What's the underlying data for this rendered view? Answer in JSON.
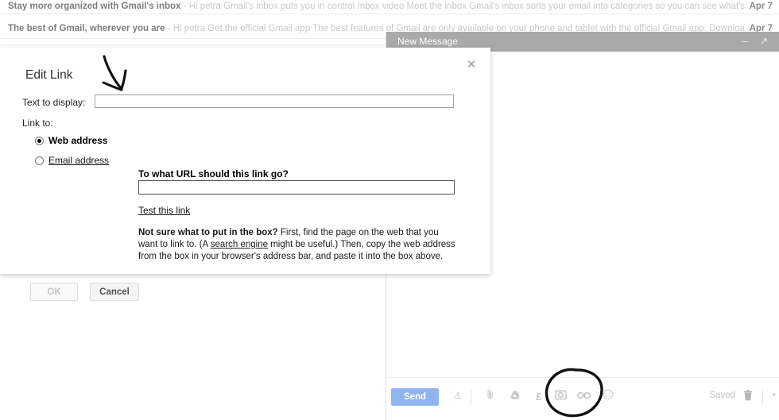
{
  "inbox": {
    "rows": [
      {
        "subject": "Stay more organized with Gmail's inbox",
        "dash": " - ",
        "snippet": "Hi petra Gmail's inbox puts you in control Inbox video Meet the inbox Gmail's inbox sorts your email into categories so you can see what's",
        "date": "Apr 7"
      },
      {
        "subject": "The best of Gmail, wherever you are",
        "dash": " - ",
        "snippet": "Hi petra Get the official Gmail app The best features of Gmail are only available on your phone and tablet with the official Gmail app. Downloa",
        "date": "Apr 7"
      }
    ]
  },
  "compose": {
    "title": "New Message",
    "minimize_icon": "minimize-icon",
    "minimize_glyph": "–",
    "expand_icon": "expand-icon",
    "expand_glyph": "↗",
    "toolbar": {
      "send_label": "Send",
      "format_icon": "format-text-icon",
      "format_glyph": "A",
      "attach_icon": "paperclip-attach-icon",
      "attach_glyph": "📎",
      "drive_icon": "google-drive-icon",
      "money_icon": "money-pound-icon",
      "money_glyph": "£",
      "photo_icon": "insert-photo-icon",
      "link_icon": "insert-link-icon",
      "emoji_icon": "insert-emoji-icon",
      "saved_label": "Saved",
      "trash_icon": "trash-discard-icon",
      "more_icon": "more-options-chevron-icon",
      "more_glyph": "▾"
    }
  },
  "dialog": {
    "title": "Edit Link",
    "close_icon": "close-icon",
    "close_glyph": "✕",
    "text_to_display_label": "Text to display:",
    "text_to_display_value": "",
    "text_to_display_placeholder": "",
    "link_to_label": "Link to:",
    "radio_web_label": "Web address",
    "radio_email_label": "Email address",
    "url_heading": "To what URL should this link go?",
    "url_value": "",
    "url_placeholder": "",
    "test_link_label": "Test this link",
    "help_bold": "Not sure what to put in the box?",
    "help_text_1": " First, find the page on the web that you want to link to. (A ",
    "help_link": "search engine",
    "help_text_2": " might be useful.) Then, copy the web address from the box in your browser's address bar, and paste it into the box above.",
    "ok_label": "OK",
    "cancel_label": "Cancel"
  },
  "annotations": {
    "arrow": "hand-drawn-arrow-pointing-to-text-field",
    "circle": "hand-drawn-circle-around-link-icon"
  },
  "colors": {
    "send_button": "#8fb4ef",
    "compose_header": "#a9a9a9",
    "annotation_ink": "#111111"
  }
}
